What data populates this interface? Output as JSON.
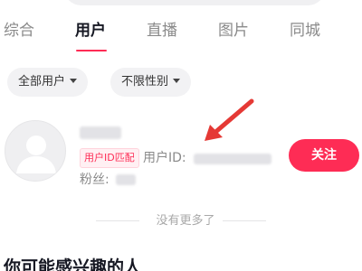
{
  "tabs": [
    {
      "label": "综合"
    },
    {
      "label": "用户"
    },
    {
      "label": "直播"
    },
    {
      "label": "图片"
    },
    {
      "label": "同城"
    }
  ],
  "active_tab": "用户",
  "filters": {
    "user_type": "全部用户",
    "gender": "不限性别"
  },
  "result": {
    "badge": "用户ID匹配",
    "uid_label": "用户ID:",
    "fans_label": "粉丝:",
    "follow_label": "关注"
  },
  "no_more": "没有更多了",
  "section_title": "你可能感兴趣的人",
  "colors": {
    "accent": "#fe2c55",
    "arrow": "#e53935"
  }
}
